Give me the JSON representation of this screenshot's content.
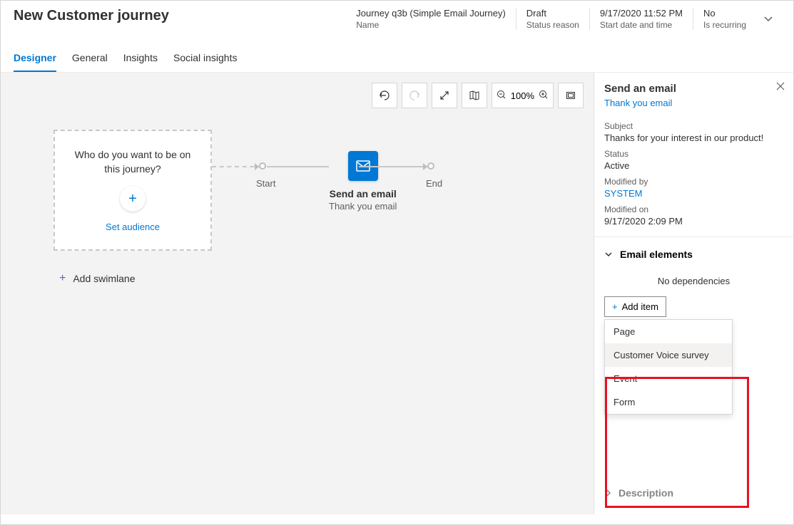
{
  "header": {
    "title": "New Customer journey",
    "fields": [
      {
        "value": "Journey q3b (Simple Email Journey)",
        "label": "Name"
      },
      {
        "value": "Draft",
        "label": "Status reason"
      },
      {
        "value": "9/17/2020 11:52 PM",
        "label": "Start date and time"
      },
      {
        "value": "No",
        "label": "Is recurring"
      }
    ]
  },
  "tabs": [
    "Designer",
    "General",
    "Insights",
    "Social insights"
  ],
  "active_tab": 0,
  "toolbar": {
    "zoom": "100%"
  },
  "audience": {
    "question": "Who do you want to be on this journey?",
    "action": "Set audience"
  },
  "add_swimlane": "Add swimlane",
  "flow": {
    "start": "Start",
    "end": "End",
    "email_title": "Send an email",
    "email_sub": "Thank you email"
  },
  "panel": {
    "title": "Send an email",
    "link": "Thank you email",
    "subject_label": "Subject",
    "subject_value": "Thanks for your interest in our product!",
    "status_label": "Status",
    "status_value": "Active",
    "modby_label": "Modified by",
    "modby_value": "SYSTEM",
    "modon_label": "Modified on",
    "modon_value": "9/17/2020 2:09 PM",
    "section_elements": "Email elements",
    "no_deps": "No dependencies",
    "add_item": "Add item",
    "options": [
      "Page",
      "Customer Voice survey",
      "Event",
      "Form"
    ],
    "hover_index": 1,
    "section_desc": "Description"
  }
}
